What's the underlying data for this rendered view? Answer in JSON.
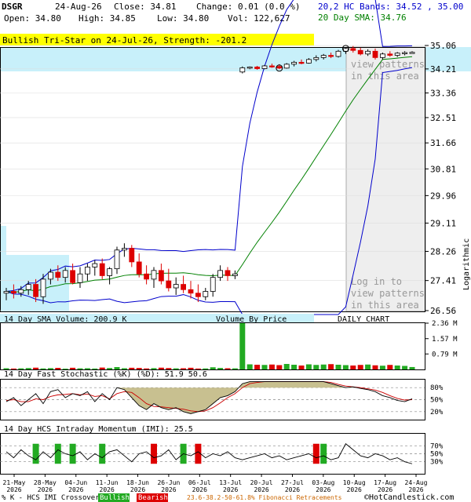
{
  "header": {
    "symbol": "DSGR",
    "date": "24-Aug-26",
    "close_label": "Close: 34.81",
    "change_label": "Change: 0.01 (0.0 %)",
    "open_label": "Open: 34.80",
    "high_label": "High: 34.85",
    "low_label": "Low: 34.80",
    "vol_label": "Vol: 122,627",
    "bands_label": "20,2 HC Bands: 34.52 , 35.00",
    "sma_label": "20 Day SMA: 34.76"
  },
  "pattern_banner": "Bullish Tri-Star on 24-Jul-26, Strength: -201.2",
  "login_notice_top": [
    "view patterns",
    "in this area"
  ],
  "login_notice_bottom": [
    "Log in to",
    "view patterns",
    "in this area"
  ],
  "panel_labels": {
    "volume": "14 Day SMA Volume: 200.9 K",
    "volume_by_price": "Volume By Price",
    "daily_chart": "DAILY CHART",
    "stochastic": "14 Day Fast Stochastic (%K) (%D): 51.9   50.6",
    "imi": "14 Day HCS Intraday Momentum (IMI): 25.5",
    "side_scale": "Logarithmic"
  },
  "footer": {
    "crossover_label": "% K - HCS IMI Crossover,",
    "bullish": "Bullish",
    "bearish": "Bearish",
    "fib": "23.6-38.2-50-61.8% Fibonacci Retracements",
    "credit": "©HotCandlestick.com"
  },
  "colors": {
    "up": "#000000",
    "down": "#dd0000",
    "volume_up": "#22aa22",
    "volume_down": "#dd0000",
    "sma": "#008000",
    "bands": "#0000cc",
    "banner": "#ffff00",
    "highlight": "#c8f0fa"
  },
  "chart_data": {
    "type": "candlestick",
    "price_axis_ticks": [
      "35.06",
      "34.21",
      "33.36",
      "32.51",
      "31.66",
      "30.81",
      "29.96",
      "29.11",
      "28.26",
      "27.41",
      "26.56"
    ],
    "price_scale": "log",
    "volume_axis_ticks": [
      "2.36 M",
      "1.57 M",
      "0.79 M"
    ],
    "stochastic_ticks": [
      "80%",
      "50%",
      "20%"
    ],
    "imi_ticks": [
      "70%",
      "50%",
      "30%"
    ],
    "x_tick_labels": [
      [
        "21-May",
        "2026"
      ],
      [
        "28-May",
        "2026"
      ],
      [
        "04-Jun",
        "2026"
      ],
      [
        "11-Jun",
        "2026"
      ],
      [
        "18-Jun",
        "2026"
      ],
      [
        "26-Jun",
        "2026"
      ],
      [
        "06-Jul",
        "2026"
      ],
      [
        "13-Jul",
        "2026"
      ],
      [
        "20-Jul",
        "2026"
      ],
      [
        "27-Jul",
        "2026"
      ],
      [
        "03-Aug",
        "2026"
      ],
      [
        "10-Aug",
        "2026"
      ],
      [
        "17-Aug",
        "2026"
      ],
      [
        "24-Aug",
        "2026"
      ]
    ],
    "candles": [
      [
        27.05,
        27.2,
        26.85,
        27.1
      ],
      [
        27.1,
        27.3,
        26.9,
        27.05
      ],
      [
        27.05,
        27.25,
        26.95,
        27.15
      ],
      [
        27.15,
        27.4,
        27.0,
        27.3
      ],
      [
        27.3,
        27.45,
        26.8,
        26.95
      ],
      [
        26.95,
        27.6,
        26.75,
        27.45
      ],
      [
        27.45,
        27.75,
        27.3,
        27.65
      ],
      [
        27.65,
        27.85,
        27.4,
        27.5
      ],
      [
        27.5,
        27.8,
        27.35,
        27.7
      ],
      [
        27.7,
        27.9,
        27.3,
        27.35
      ],
      [
        27.35,
        27.8,
        27.2,
        27.6
      ],
      [
        27.6,
        27.9,
        27.4,
        27.8
      ],
      [
        27.8,
        28.0,
        27.55,
        27.9
      ],
      [
        27.9,
        28.05,
        27.45,
        27.55
      ],
      [
        27.55,
        27.8,
        27.3,
        27.75
      ],
      [
        27.75,
        28.4,
        27.6,
        28.3
      ],
      [
        28.3,
        28.5,
        28.1,
        28.35
      ],
      [
        28.35,
        28.45,
        27.8,
        27.95
      ],
      [
        27.95,
        28.2,
        27.5,
        27.6
      ],
      [
        27.6,
        27.85,
        27.3,
        27.45
      ],
      [
        27.45,
        27.8,
        27.2,
        27.7
      ],
      [
        27.7,
        27.9,
        27.3,
        27.4
      ],
      [
        27.4,
        27.75,
        27.1,
        27.2
      ],
      [
        27.2,
        27.5,
        27.0,
        27.3
      ],
      [
        27.3,
        27.55,
        27.05,
        27.15
      ],
      [
        27.15,
        27.4,
        26.9,
        27.05
      ],
      [
        27.05,
        27.3,
        26.8,
        26.95
      ],
      [
        26.95,
        27.2,
        26.85,
        27.1
      ],
      [
        27.1,
        27.6,
        26.95,
        27.5
      ],
      [
        27.5,
        27.85,
        27.4,
        27.7
      ],
      [
        27.7,
        27.8,
        27.4,
        27.55
      ],
      [
        27.55,
        27.7,
        27.45,
        27.6
      ],
      [
        34.1,
        34.3,
        34.05,
        34.25
      ],
      [
        34.25,
        34.3,
        34.2,
        34.28
      ],
      [
        34.28,
        34.32,
        34.18,
        34.22
      ],
      [
        34.22,
        34.35,
        34.2,
        34.32
      ],
      [
        34.32,
        34.4,
        34.25,
        34.3
      ],
      [
        34.3,
        34.38,
        34.2,
        34.24
      ],
      [
        34.24,
        34.42,
        34.22,
        34.38
      ],
      [
        34.38,
        34.5,
        34.3,
        34.45
      ],
      [
        34.45,
        34.55,
        34.38,
        34.42
      ],
      [
        34.42,
        34.6,
        34.4,
        34.55
      ],
      [
        34.55,
        34.7,
        34.48,
        34.62
      ],
      [
        34.62,
        34.75,
        34.55,
        34.7
      ],
      [
        34.7,
        34.8,
        34.6,
        34.66
      ],
      [
        34.66,
        34.9,
        34.62,
        34.85
      ],
      [
        34.85,
        35.0,
        34.75,
        34.95
      ],
      [
        34.95,
        35.04,
        34.8,
        34.88
      ],
      [
        34.88,
        34.98,
        34.7,
        34.75
      ],
      [
        34.75,
        34.92,
        34.68,
        34.85
      ],
      [
        34.85,
        34.95,
        34.55,
        34.62
      ],
      [
        34.62,
        34.8,
        34.55,
        34.75
      ],
      [
        34.75,
        34.85,
        34.65,
        34.7
      ],
      [
        34.7,
        34.82,
        34.64,
        34.78
      ],
      [
        34.78,
        34.85,
        34.7,
        34.8
      ],
      [
        34.8,
        34.85,
        34.8,
        34.81
      ]
    ],
    "volumes": [
      60000,
      45000,
      55000,
      70000,
      90000,
      50000,
      65000,
      80000,
      40000,
      85000,
      55000,
      60000,
      45000,
      95000,
      70000,
      120000,
      60000,
      85000,
      75000,
      50000,
      65000,
      90000,
      70000,
      55000,
      60000,
      85000,
      45000,
      50000,
      110000,
      75000,
      60000,
      55000,
      2360000,
      260000,
      240000,
      230000,
      250000,
      220000,
      280000,
      240000,
      200000,
      260000,
      230000,
      250000,
      270000,
      240000,
      220000,
      200000,
      230000,
      250000,
      210000,
      190000,
      230000,
      200000,
      180000,
      122627
    ],
    "stoch_k": [
      45,
      55,
      35,
      50,
      65,
      40,
      70,
      75,
      55,
      65,
      60,
      70,
      45,
      65,
      50,
      80,
      75,
      55,
      35,
      25,
      40,
      30,
      25,
      30,
      20,
      15,
      20,
      25,
      40,
      55,
      60,
      70,
      90,
      95,
      95,
      95,
      95,
      95,
      95,
      95,
      95,
      95,
      95,
      95,
      90,
      85,
      80,
      82,
      78,
      75,
      70,
      60,
      55,
      48,
      45,
      52
    ],
    "stoch_d": [
      48,
      50,
      45,
      45,
      52,
      50,
      58,
      62,
      63,
      65,
      62,
      64,
      58,
      60,
      52,
      65,
      70,
      68,
      55,
      40,
      33,
      32,
      30,
      28,
      26,
      22,
      20,
      22,
      30,
      42,
      55,
      65,
      80,
      90,
      93,
      95,
      95,
      95,
      95,
      95,
      95,
      95,
      95,
      95,
      93,
      88,
      84,
      82,
      80,
      77,
      74,
      68,
      60,
      53,
      49,
      50
    ],
    "imi": [
      55,
      40,
      60,
      45,
      35,
      55,
      40,
      60,
      50,
      45,
      55,
      35,
      50,
      40,
      55,
      60,
      45,
      30,
      50,
      55,
      40,
      45,
      60,
      35,
      50,
      45,
      55,
      40,
      50,
      45,
      55,
      40,
      35,
      40,
      45,
      50,
      40,
      45,
      35,
      40,
      45,
      50,
      40,
      45,
      35,
      40,
      75,
      60,
      45,
      40,
      50,
      45,
      35,
      40,
      30,
      25
    ],
    "imi_crossovers": [
      {
        "index": 4,
        "type": "bullish"
      },
      {
        "index": 7,
        "type": "bullish"
      },
      {
        "index": 9,
        "type": "bullish"
      },
      {
        "index": 13,
        "type": "bullish"
      },
      {
        "index": 20,
        "type": "bearish"
      },
      {
        "index": 24,
        "type": "bullish"
      },
      {
        "index": 26,
        "type": "bearish"
      },
      {
        "index": 42,
        "type": "bearish"
      },
      {
        "index": 43,
        "type": "bullish"
      }
    ]
  }
}
